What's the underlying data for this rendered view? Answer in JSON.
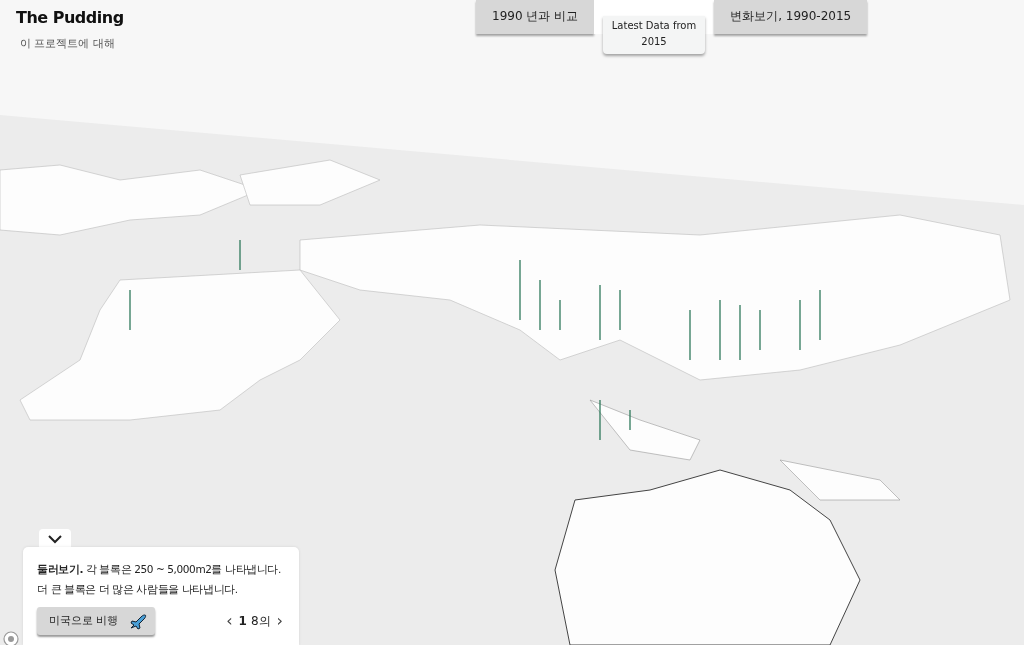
{
  "brand": {
    "logo": "The Pudding",
    "about_link": "이 프로젝트에 대해"
  },
  "tabs": [
    {
      "label": "1990 년과 비교",
      "selected": false
    },
    {
      "selected": true,
      "tooltip": "Latest Data from 2015"
    },
    {
      "label": "변화보기, 1990-2015",
      "selected": false
    }
  ],
  "panel": {
    "description": "**둘러보기.** 각 블록은 250 ~ 5,000m2를 나타냅니다. 더 큰 블록은 더 많은 사람들을 나타냅니다.",
    "fly_button": "미국으로 비행",
    "pager": {
      "prev": "‹",
      "current": "1",
      "total": "8의",
      "next": "›"
    }
  }
}
